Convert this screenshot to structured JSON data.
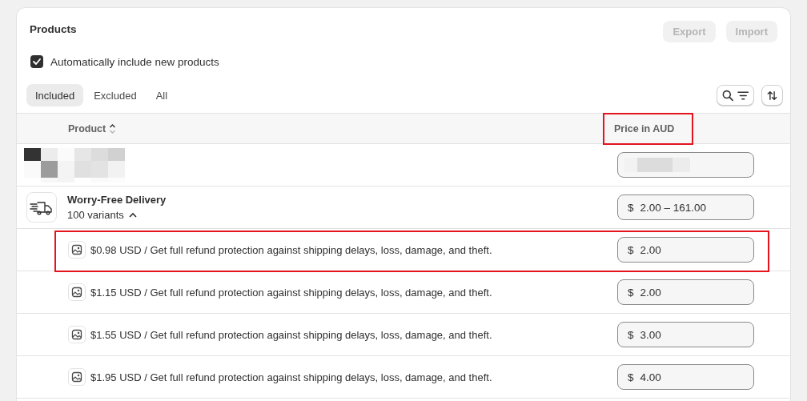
{
  "card": {
    "title": "Products",
    "actions": [
      {
        "label": "Export",
        "disabled": true
      },
      {
        "label": "Import",
        "disabled": true
      }
    ]
  },
  "auto_include": {
    "label": "Automatically include new products",
    "checked": true
  },
  "tabs": [
    {
      "label": "Included",
      "selected": true
    },
    {
      "label": "Excluded",
      "selected": false
    },
    {
      "label": "All",
      "selected": false
    }
  ],
  "table": {
    "columns": [
      {
        "label": "Product",
        "sortable": true,
        "highlighted": false
      },
      {
        "label": "Price in AUD",
        "sortable": false,
        "highlighted": true
      }
    ],
    "rows": [
      {
        "kind": "redacted"
      },
      {
        "kind": "product",
        "name": "Worry-Free Delivery",
        "variants": "100 variants",
        "expanded": true,
        "price_prefix": "$",
        "price": "2.00 – 161.00"
      },
      {
        "kind": "variant",
        "title": "$0.98 USD / Get full refund protection against shipping delays, loss, damage, and theft.",
        "price_prefix": "$",
        "price": "2.00",
        "highlighted": true
      },
      {
        "kind": "variant",
        "title": "$1.15 USD / Get full refund protection against shipping delays, loss, damage, and theft.",
        "price_prefix": "$",
        "price": "2.00",
        "highlighted": false
      },
      {
        "kind": "variant",
        "title": "$1.55 USD / Get full refund protection against shipping delays, loss, damage, and theft.",
        "price_prefix": "$",
        "price": "3.00",
        "highlighted": false
      },
      {
        "kind": "variant",
        "title": "$1.95 USD / Get full refund protection against shipping delays, loss, damage, and theft.",
        "price_prefix": "$",
        "price": "4.00",
        "highlighted": false
      }
    ]
  }
}
